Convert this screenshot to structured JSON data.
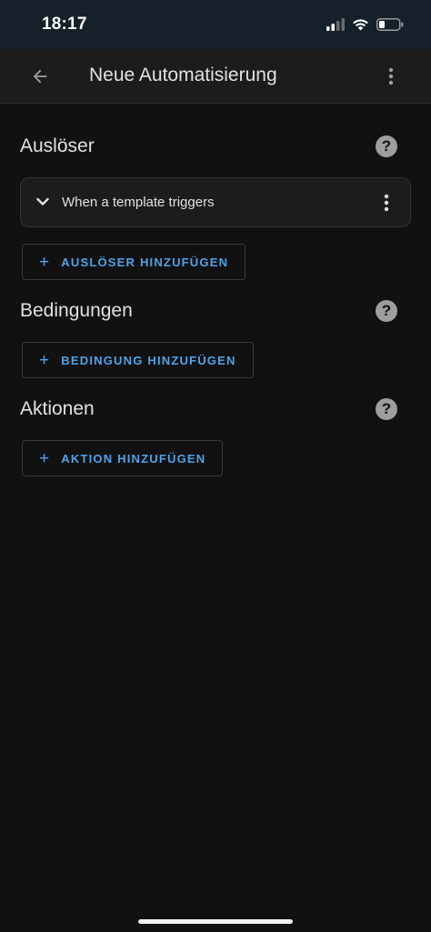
{
  "status": {
    "time": "18:17"
  },
  "appbar": {
    "title": "Neue Automatisierung",
    "back_icon": "arrow-left-icon",
    "menu_icon": "dots-vertical-icon"
  },
  "sections": {
    "triggers": {
      "title": "Auslöser",
      "items": [
        {
          "label": "When a template triggers"
        }
      ],
      "add_label": "AUSLÖSER HINZUFÜGEN"
    },
    "conditions": {
      "title": "Bedingungen",
      "add_label": "BEDINGUNG HINZUFÜGEN"
    },
    "actions": {
      "title": "Aktionen",
      "add_label": "AKTION HINZUFÜGEN"
    }
  },
  "icons": {
    "plus": "+",
    "help": "?"
  },
  "colors": {
    "accent": "#4fa3e8",
    "background": "#111111",
    "appbar": "#1c1c1c"
  }
}
